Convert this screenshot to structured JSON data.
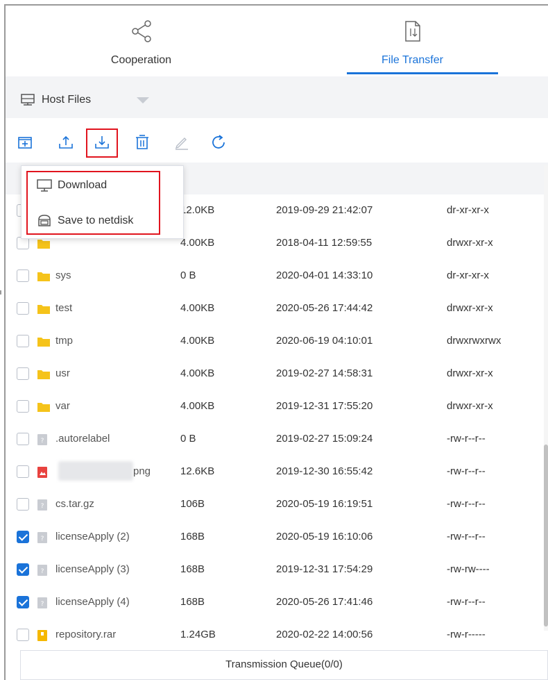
{
  "tabs": [
    {
      "label": "Cooperation",
      "icon": "share-icon",
      "active": false
    },
    {
      "label": "File Transfer",
      "icon": "file-transfer-icon",
      "active": true
    }
  ],
  "host": {
    "label": "Host Files",
    "icon": "host-icon"
  },
  "toolbar": {
    "items": [
      "new-folder-icon",
      "upload-icon",
      "download-icon",
      "delete-icon",
      "rename-icon",
      "refresh-icon"
    ]
  },
  "menu": {
    "download_label": "Download",
    "save_netdisk_label": "Save to netdisk"
  },
  "rows": [
    {
      "name": "",
      "size": "12.0KB",
      "date": "2019-09-29 21:42:07",
      "perm": "dr-xr-xr-x",
      "checked": false,
      "type": "folder"
    },
    {
      "name": "",
      "size": "4.00KB",
      "date": "2018-04-11 12:59:55",
      "perm": "drwxr-xr-x",
      "checked": false,
      "type": "folder"
    },
    {
      "name": "sys",
      "size": "0 B",
      "date": "2020-04-01 14:33:10",
      "perm": "dr-xr-xr-x",
      "checked": false,
      "type": "folder"
    },
    {
      "name": "test",
      "size": "4.00KB",
      "date": "2020-05-26 17:44:42",
      "perm": "drwxr-xr-x",
      "checked": false,
      "type": "folder"
    },
    {
      "name": "tmp",
      "size": "4.00KB",
      "date": "2020-06-19 04:10:01",
      "perm": "drwxrwxrwx",
      "checked": false,
      "type": "folder"
    },
    {
      "name": "usr",
      "size": "4.00KB",
      "date": "2019-02-27 14:58:31",
      "perm": "drwxr-xr-x",
      "checked": false,
      "type": "folder"
    },
    {
      "name": "var",
      "size": "4.00KB",
      "date": "2019-12-31 17:55:20",
      "perm": "drwxr-xr-x",
      "checked": false,
      "type": "folder"
    },
    {
      "name": ".autorelabel",
      "size": "0 B",
      "date": "2019-02-27 15:09:24",
      "perm": "-rw-r--r--",
      "checked": false,
      "type": "file"
    },
    {
      "name": "png",
      "size": "12.6KB",
      "date": "2019-12-30 16:55:42",
      "perm": "-rw-r--r--",
      "checked": false,
      "type": "image"
    },
    {
      "name": "cs.tar.gz",
      "size": "106B",
      "date": "2020-05-19 16:19:51",
      "perm": "-rw-r--r--",
      "checked": false,
      "type": "file"
    },
    {
      "name": "licenseApply (2)",
      "size": "168B",
      "date": "2020-05-19 16:10:06",
      "perm": "-rw-r--r--",
      "checked": true,
      "type": "file"
    },
    {
      "name": "licenseApply (3)",
      "size": "168B",
      "date": "2019-12-31 17:54:29",
      "perm": "-rw-rw----",
      "checked": true,
      "type": "file"
    },
    {
      "name": "licenseApply (4)",
      "size": "168B",
      "date": "2020-05-26 17:41:46",
      "perm": "-rw-r--r--",
      "checked": true,
      "type": "file"
    },
    {
      "name": "repository.rar",
      "size": "1.24GB",
      "date": "2020-02-22 14:00:56",
      "perm": "-rw-r-----",
      "checked": false,
      "type": "archive"
    }
  ],
  "queue_label": "Transmission Queue(0/0)",
  "colors": {
    "accent": "#1a73d9",
    "highlight": "#e1141e",
    "folder": "#f5c31a",
    "image_file": "#e8423f",
    "archive": "#f5b800"
  }
}
